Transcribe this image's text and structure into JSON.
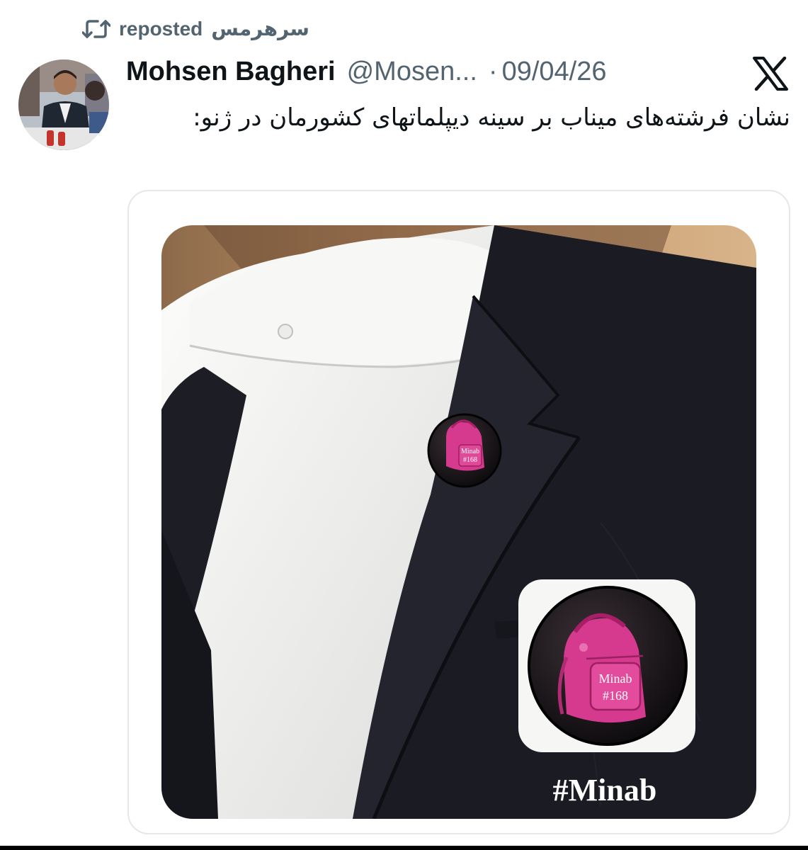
{
  "repost": {
    "reposter": "سرهرمس",
    "label": "reposted",
    "icon": "repost-icon"
  },
  "post": {
    "author_name": "Mohsen Bagheri",
    "author_handle": "@Mosen...",
    "separator": "·",
    "date": "09/04/26",
    "platform_icon": "x-logo-icon",
    "text": "نشان فرشته‌های میناب بر سینه دیپلماتهای کشورمان در ژنو:"
  },
  "media": {
    "pin_small_line1": "Minab",
    "pin_small_line2": "#168",
    "pin_large_line1": "Minab",
    "pin_large_line2": "#168",
    "hashtag": "#Minab"
  },
  "colors": {
    "text_primary": "#0f1419",
    "text_secondary": "#536471",
    "card_border": "#e4e8eb",
    "jacket": "#1a1a22",
    "shirt": "#f4f4f2",
    "skin": "#b8865a",
    "pin_bg": "#161216",
    "backpack_pink": "#d63a8e"
  }
}
